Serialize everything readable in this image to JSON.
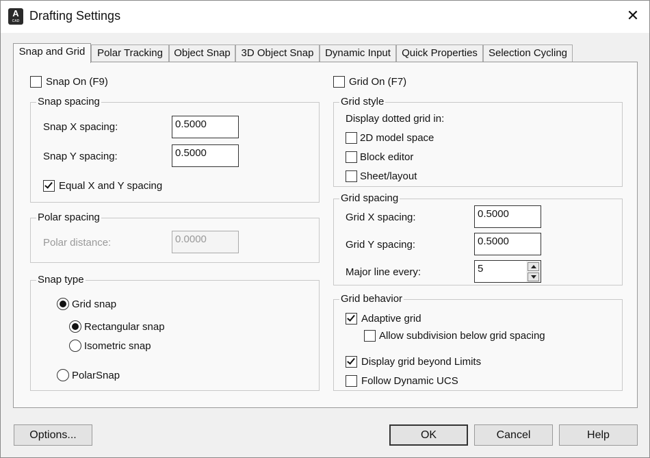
{
  "window": {
    "title": "Drafting Settings",
    "close_glyph": "✕",
    "app_icon_letter": "A",
    "app_icon_sub": "CAD"
  },
  "tabs": [
    "Snap and Grid",
    "Polar Tracking",
    "Object Snap",
    "3D Object Snap",
    "Dynamic Input",
    "Quick Properties",
    "Selection Cycling"
  ],
  "snap": {
    "snap_on_label": "Snap On (F9)",
    "snap_on_checked": false,
    "spacing_title": "Snap spacing",
    "x_label": "Snap X spacing:",
    "x_value": "0.5000",
    "y_label": "Snap Y spacing:",
    "y_value": "0.5000",
    "equal_label": "Equal X and Y spacing",
    "equal_checked": true
  },
  "polar": {
    "title": "Polar spacing",
    "distance_label": "Polar distance:",
    "distance_value": "0.0000"
  },
  "snap_type": {
    "title": "Snap type",
    "grid_snap": "Grid snap",
    "rect_snap": "Rectangular snap",
    "iso_snap": "Isometric snap",
    "polar_snap": "PolarSnap",
    "selected": "grid_snap",
    "sub_selected": "rect_snap"
  },
  "grid": {
    "grid_on_label": "Grid On (F7)",
    "grid_on_checked": false,
    "style_title": "Grid style",
    "dotted_label": "Display dotted grid in:",
    "model_space": "2D model space",
    "block_editor": "Block editor",
    "sheet_layout": "Sheet/layout",
    "spacing_title": "Grid spacing",
    "x_label": "Grid X spacing:",
    "x_value": "0.5000",
    "y_label": "Grid Y spacing:",
    "y_value": "0.5000",
    "major_label": "Major line every:",
    "major_value": "5",
    "behavior_title": "Grid behavior",
    "adaptive": "Adaptive grid",
    "adaptive_checked": true,
    "subdivision": "Allow subdivision below grid spacing",
    "subdivision_checked": false,
    "beyond_limits": "Display grid beyond Limits",
    "beyond_limits_checked": true,
    "follow_ucs": "Follow Dynamic UCS",
    "follow_ucs_checked": false
  },
  "buttons": {
    "options": "Options...",
    "ok": "OK",
    "cancel": "Cancel",
    "help": "Help"
  }
}
